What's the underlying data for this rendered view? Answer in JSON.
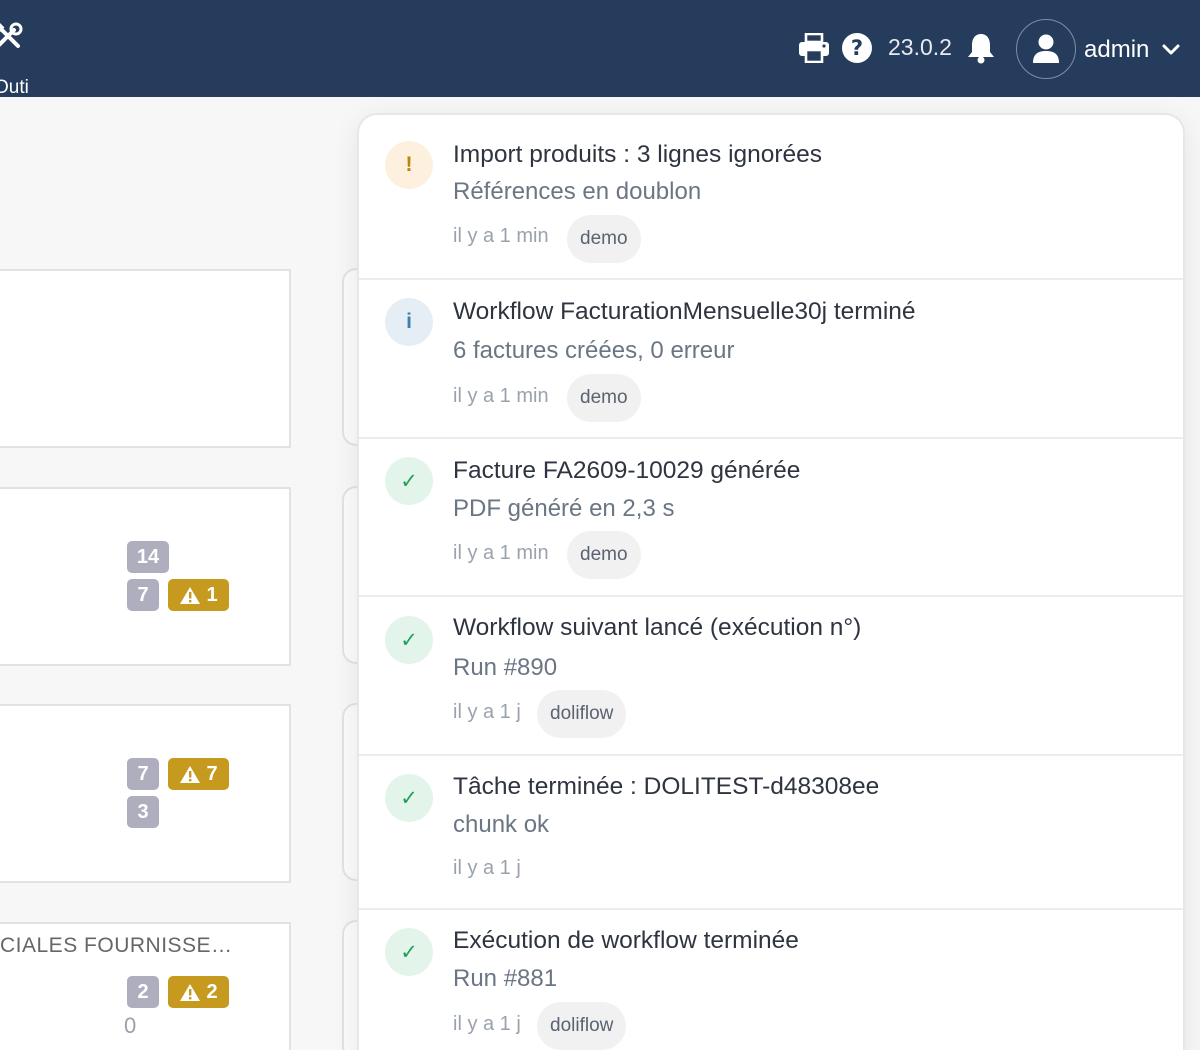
{
  "topbar": {
    "tools_label": "Outils",
    "version": "23.0.2",
    "username": "admin",
    "icons": [
      "tools-icon",
      "print-icon",
      "help-icon",
      "bell-icon",
      "user-icon",
      "chevron-down-icon"
    ]
  },
  "background": {
    "cards": [
      {
        "badges": []
      },
      {
        "badges": [
          {
            "text": "14",
            "kind": "gray"
          },
          {
            "text": "7",
            "kind": "gray"
          },
          {
            "text": "1",
            "kind": "warning"
          }
        ]
      },
      {
        "badges": [
          {
            "text": "7",
            "kind": "gray"
          },
          {
            "text": "7",
            "kind": "warning"
          },
          {
            "text": "3",
            "kind": "gray"
          }
        ]
      },
      {
        "title": "CIALES FOURNISSE…",
        "badges": [
          {
            "text": "2",
            "kind": "gray"
          },
          {
            "text": "2",
            "kind": "warning"
          }
        ],
        "value": "0"
      }
    ]
  },
  "notifications": {
    "items": [
      {
        "type": "warning",
        "icon": "!",
        "title": "Import produits : 3 lignes ignorées",
        "subtitle": "Références en doublon",
        "time": "il y a 1 min",
        "tag": "demo"
      },
      {
        "type": "info",
        "icon": "i",
        "title": "Workflow FacturationMensuelle30j terminé",
        "subtitle": "6 factures créées, 0 erreur",
        "time": "il y a 1 min",
        "tag": "demo"
      },
      {
        "type": "success",
        "icon": "✓",
        "title": "Facture FA2609-10029 générée",
        "subtitle": "PDF généré en 2,3 s",
        "time": "il y a 1 min",
        "tag": "demo"
      },
      {
        "type": "success",
        "icon": "✓",
        "title": "Workflow suivant lancé (exécution n°)",
        "subtitle": "Run #890",
        "time": "il y a 1 j",
        "tag": "doliflow"
      },
      {
        "type": "success",
        "icon": "✓",
        "title": "Tâche terminée : DOLITEST-d48308ee",
        "subtitle": "chunk ok",
        "time": "il y a 1 j",
        "tag": ""
      },
      {
        "type": "success",
        "icon": "✓",
        "title": "Exécution de workflow terminée",
        "subtitle": "Run #881",
        "time": "il y a 1 j",
        "tag": "doliflow"
      }
    ]
  },
  "colors": {
    "topbar": "#263c5c",
    "warning": "#c59a1f",
    "badge_gray": "#aeaebe",
    "success": "#23a05b",
    "info": "#3f7fb0"
  }
}
